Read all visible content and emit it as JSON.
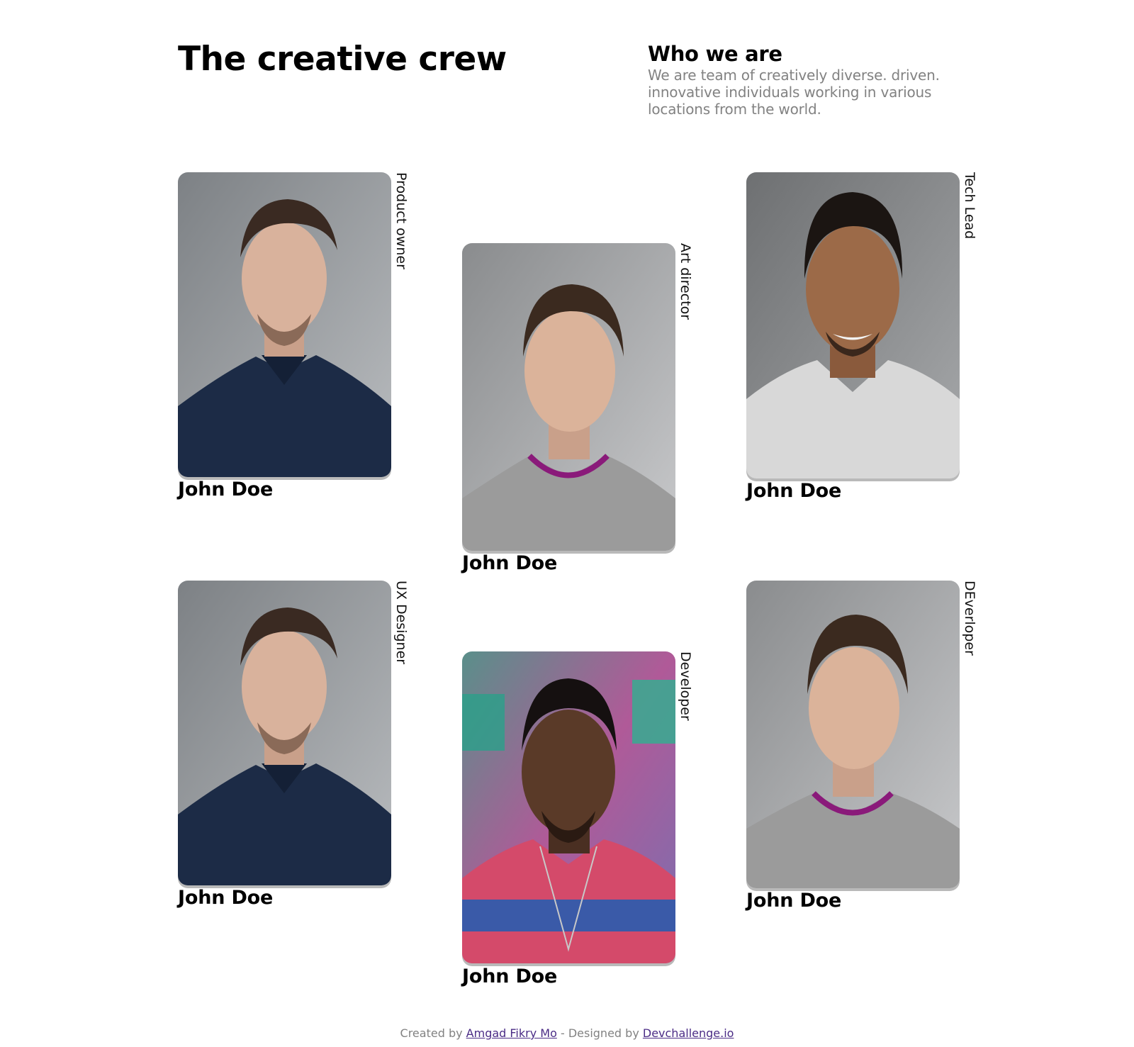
{
  "header": {
    "title": "The creative crew"
  },
  "about": {
    "heading": "Who we are",
    "text": "We are team of creatively diverse. driven. innovative individuals working in various locations from the world."
  },
  "members": [
    {
      "role": "Product owner",
      "name": "John Doe"
    },
    {
      "role": "Art director",
      "name": "John Doe"
    },
    {
      "role": "Tech Lead",
      "name": "John Doe"
    },
    {
      "role": "UX Designer",
      "name": "John Doe"
    },
    {
      "role": "Developer",
      "name": "John Doe"
    },
    {
      "role": "DEverloper",
      "name": "John Doe"
    }
  ],
  "footer": {
    "created_prefix": "Created by",
    "author_link": "Amgad Fikry Mo",
    "designed_prefix": "- Designed by",
    "designer_link": "Devchallenge.io"
  },
  "colors": {
    "background": "#ffffff",
    "heading": "#000000",
    "body_text": "#828282",
    "link": "#4b2c86"
  }
}
